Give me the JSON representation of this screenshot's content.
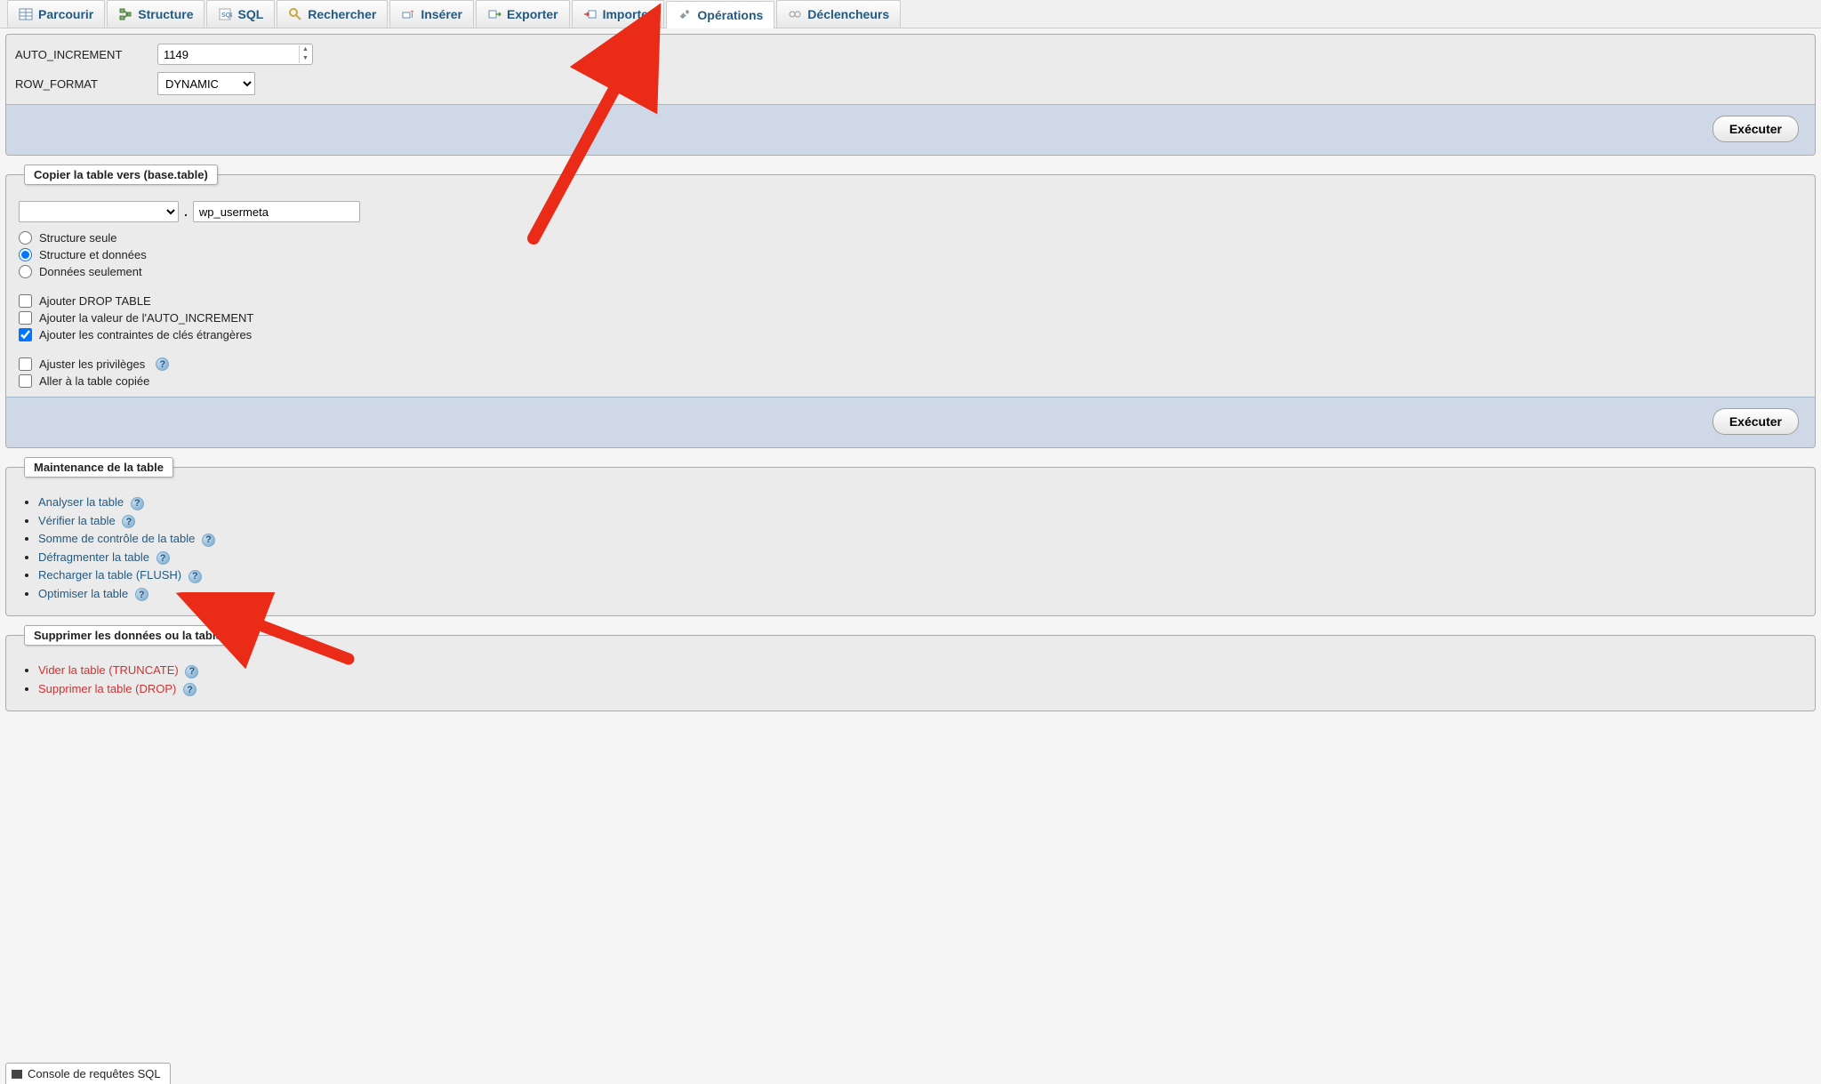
{
  "tabs": {
    "browse": "Parcourir",
    "structure": "Structure",
    "sql": "SQL",
    "search": "Rechercher",
    "insert": "Insérer",
    "export": "Exporter",
    "import": "Importer",
    "operations": "Opérations",
    "triggers": "Déclencheurs"
  },
  "options": {
    "auto_increment_label": "AUTO_INCREMENT",
    "auto_increment_value": "1149",
    "row_format_label": "ROW_FORMAT",
    "row_format_value": "DYNAMIC"
  },
  "buttons": {
    "execute": "Exécuter"
  },
  "copy": {
    "legend": "Copier la table vers (base.table)",
    "dot": ".",
    "target_value": "wp_usermeta",
    "opt_structure_only": "Structure seule",
    "opt_structure_and_data": "Structure et données",
    "opt_data_only": "Données seulement",
    "cb_drop_table": "Ajouter DROP TABLE",
    "cb_add_ai": "Ajouter la valeur de l'AUTO_INCREMENT",
    "cb_fk": "Ajouter les contraintes de clés étrangères",
    "cb_priv": "Ajuster les privilèges",
    "cb_goto": "Aller à la table copiée"
  },
  "maintenance": {
    "legend": "Maintenance de la table",
    "analyze": "Analyser la table",
    "check": "Vérifier la table",
    "checksum": "Somme de contrôle de la table",
    "defrag": "Défragmenter la table",
    "flush": "Recharger la table (FLUSH)",
    "optimize": "Optimiser la table"
  },
  "delete": {
    "legend": "Supprimer les données ou la table",
    "truncate": "Vider la table (TRUNCATE)",
    "drop": "Supprimer la table (DROP)"
  },
  "console": {
    "label": "Console de requêtes SQL"
  }
}
